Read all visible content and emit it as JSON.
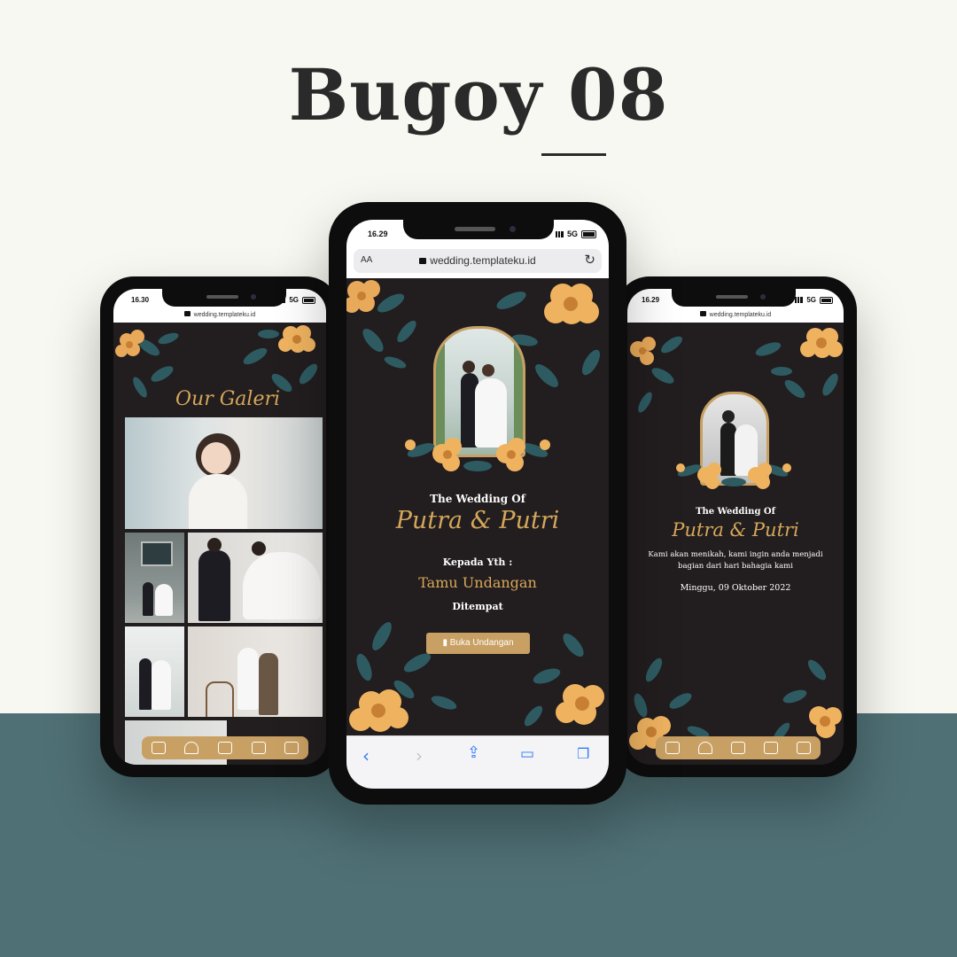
{
  "title": "Bugoy 08",
  "colors": {
    "gold": "#c9a063",
    "dark": "#221d1e",
    "teal": "#4f7075",
    "cream": "#f8f8f2"
  },
  "left_phone": {
    "time": "16.30",
    "signal": "5G",
    "url": "wedding.templateku.id",
    "gallery_title": "Our Galeri",
    "nav_icons": [
      "envelope-heart-icon",
      "couple-icon",
      "calendar-icon",
      "gift-icon",
      "guestbook-icon"
    ]
  },
  "center_phone": {
    "time": "16.29",
    "signal": "5G",
    "text_size": "AA",
    "url": "wedding.templateku.id",
    "wedding_of": "The Wedding Of",
    "couple": "Putra & Putri",
    "kepada": "Kepada Yth :",
    "guest": "Tamu Undangan",
    "ditempat": "Ditempat",
    "open_button": "Buka Undangan",
    "safari_icons": [
      "back-icon",
      "forward-icon",
      "share-icon",
      "bookmarks-icon",
      "tabs-icon"
    ]
  },
  "right_phone": {
    "time": "16.29",
    "signal": "5G",
    "url": "wedding.templateku.id",
    "wedding_of": "The Wedding Of",
    "couple": "Putra & Putri",
    "message": "Kami akan menikah, kami ingin anda menjadi bagian dari hari bahagia kami",
    "date": "Minggu, 09 Oktober 2022",
    "nav_icons": [
      "envelope-heart-icon",
      "couple-icon",
      "calendar-icon",
      "gift-icon",
      "guestbook-icon"
    ]
  }
}
